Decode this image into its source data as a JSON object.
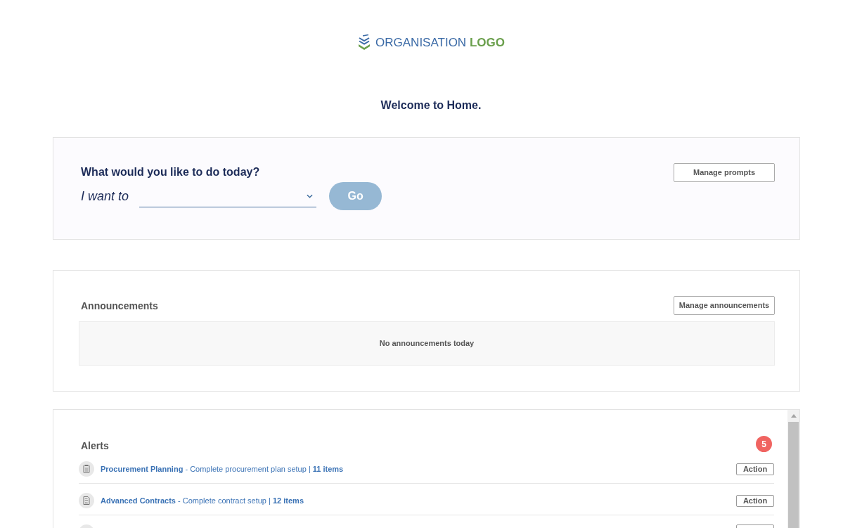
{
  "logo": {
    "text": "ORGANISATION",
    "accent": "LOGO"
  },
  "welcome": "Welcome to Home.",
  "prompt_panel": {
    "title": "What would you like to do today?",
    "label": "I want to",
    "go_button": {
      "label": "Go",
      "disabled": true
    },
    "manage_button": "Manage prompts"
  },
  "announcements": {
    "title": "Announcements",
    "manage_button": "Manage announcements",
    "empty_message": "No announcements today"
  },
  "alerts": {
    "title": "Alerts",
    "count": "5",
    "items": [
      {
        "kind": "plan",
        "text": "**Procurement Planning** - Complete procurement plan setup | **11 items**",
        "action": "Action"
      },
      {
        "kind": "contract",
        "text": "**Advanced Contracts** - Complete contract setup | **12 items**",
        "action": "Action"
      }
    ]
  }
}
